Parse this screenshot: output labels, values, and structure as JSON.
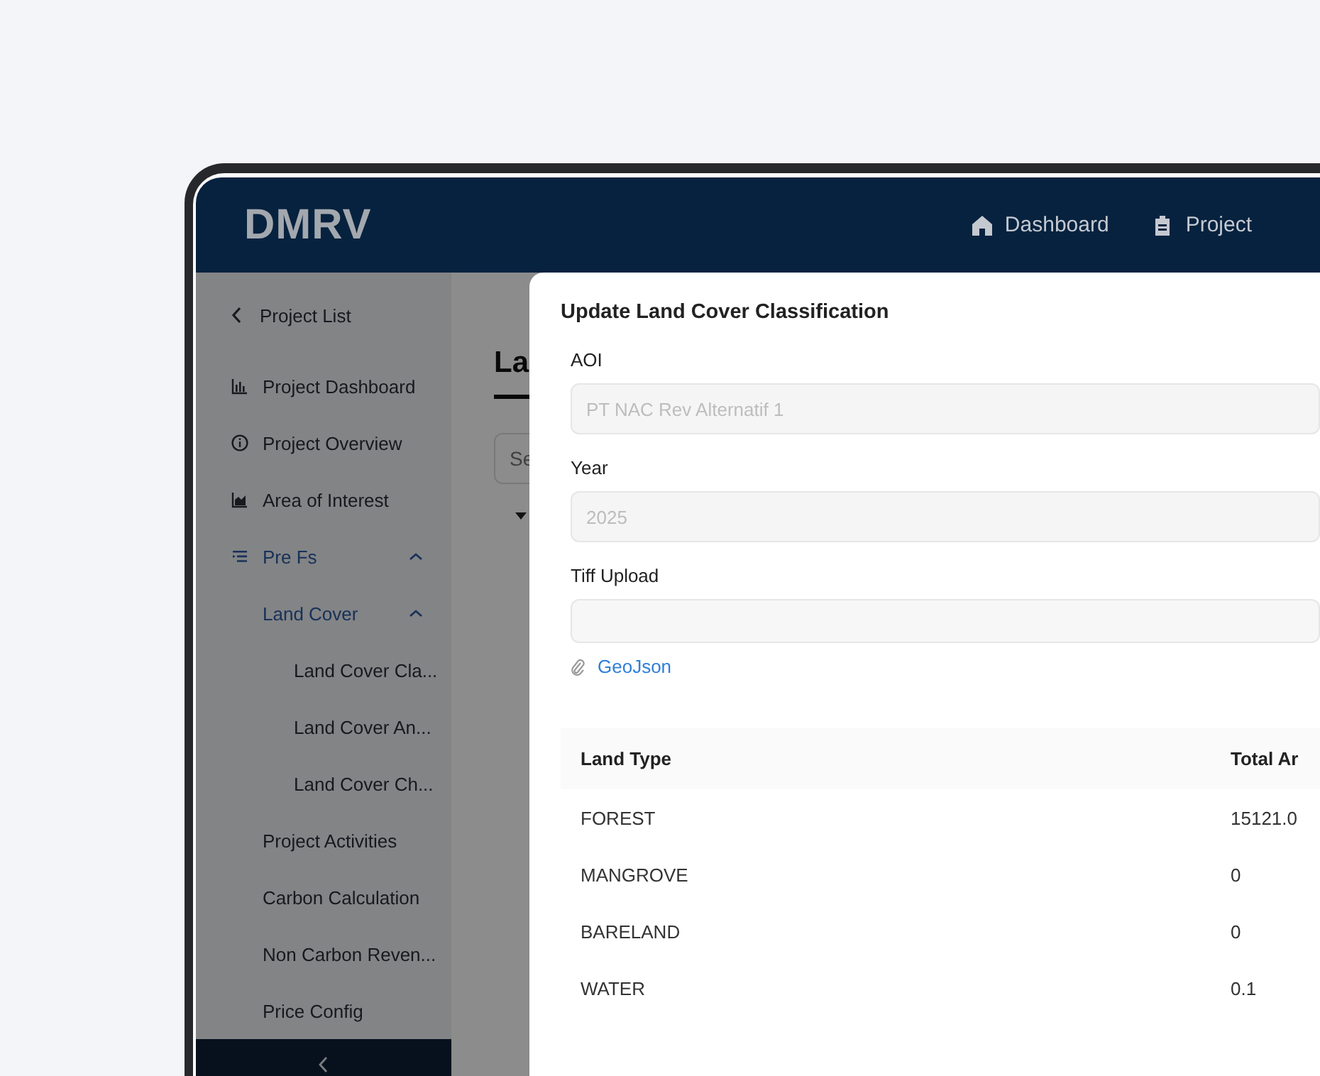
{
  "header": {
    "logo": "DMRV",
    "nav": [
      {
        "label": "Dashboard"
      },
      {
        "label": "Project"
      }
    ]
  },
  "sidebar": {
    "back": "Project List",
    "items": [
      {
        "label": "Project Dashboard",
        "active": false
      },
      {
        "label": "Project Overview",
        "active": false
      },
      {
        "label": "Area of Interest",
        "active": false
      },
      {
        "label": "Pre Fs",
        "active": true,
        "expanded": true,
        "children": [
          {
            "label": "Land Cover",
            "active": true,
            "expanded": true,
            "children": [
              {
                "label": "Land Cover Cla...",
                "active": false
              },
              {
                "label": "Land Cover An...",
                "active": false
              },
              {
                "label": "Land Cover Ch...",
                "active": false
              }
            ]
          }
        ]
      },
      {
        "label": "Project Activities",
        "active": false
      },
      {
        "label": "Carbon Calculation",
        "active": false
      },
      {
        "label": "Non Carbon Reven...",
        "active": false
      },
      {
        "label": "Price Config",
        "active": false
      }
    ]
  },
  "page": {
    "title": "La",
    "search": {
      "placeholder": "Se"
    }
  },
  "modal": {
    "title": "Update Land Cover Classification",
    "fields": [
      {
        "kind": "text",
        "label": "AOI",
        "value": "PT NAC Rev Alternatif 1",
        "disabled": true
      },
      {
        "kind": "text",
        "label": "Year",
        "value": "2025",
        "disabled": true
      },
      {
        "kind": "upload",
        "label": "Tiff Upload"
      }
    ],
    "attachment": "GeoJson",
    "table": {
      "columns": [
        "Land Type",
        "Total Ar"
      ],
      "rows": [
        [
          "FOREST",
          "15121.0"
        ],
        [
          "MANGROVE",
          "0"
        ],
        [
          "BARELAND",
          "0"
        ],
        [
          "WATER",
          "0.1"
        ]
      ]
    }
  }
}
